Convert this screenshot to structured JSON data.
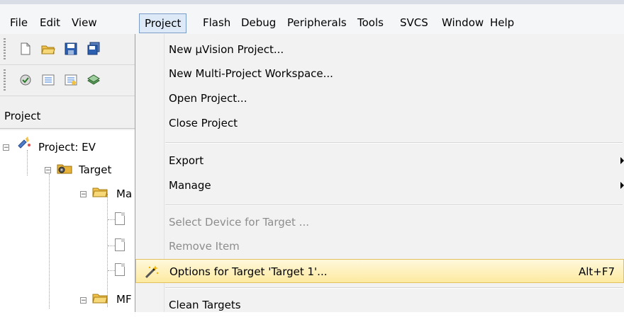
{
  "menubar": {
    "items": [
      {
        "label": "File"
      },
      {
        "label": "Edit"
      },
      {
        "label": "View"
      },
      {
        "label": "Project",
        "active": true
      },
      {
        "label": "Flash"
      },
      {
        "label": "Debug"
      },
      {
        "label": "Peripherals"
      },
      {
        "label": "Tools"
      },
      {
        "label": "SVCS"
      },
      {
        "label": "Window"
      },
      {
        "label": "Help"
      }
    ]
  },
  "toolbar1": {
    "icons": [
      "new-file-icon",
      "open-folder-icon",
      "save-icon",
      "save-all-icon"
    ]
  },
  "toolbar2": {
    "icons": [
      "translate-icon",
      "build-icon",
      "rebuild-icon",
      "batch-build-icon"
    ]
  },
  "project_panel": {
    "title": "Project",
    "tree": {
      "root": "Project: EV",
      "target": "Target",
      "group1": "Ma",
      "group2": "MF"
    }
  },
  "project_menu": {
    "items": [
      {
        "label": "New µVision Project..."
      },
      {
        "label": "New Multi-Project Workspace..."
      },
      {
        "label": "Open Project..."
      },
      {
        "label": "Close Project"
      },
      {
        "label": "Export",
        "submenu": true
      },
      {
        "label": "Manage",
        "submenu": true
      },
      {
        "label": "Select Device for Target ...",
        "disabled": true
      },
      {
        "label": "Remove Item",
        "disabled": true
      },
      {
        "label": "Options for Target 'Target 1'...",
        "shortcut": "Alt+F7",
        "highlighted": true,
        "icon": "magic-wand-icon"
      },
      {
        "label": "Clean Targets"
      }
    ]
  },
  "colors": {
    "menu_active_bg": "#dde9f6",
    "menu_active_border": "#7a9cc6",
    "highlight_bg": "#fdeaa0",
    "highlight_border": "#e3c05f",
    "disabled_text": "#8d8d8d"
  }
}
